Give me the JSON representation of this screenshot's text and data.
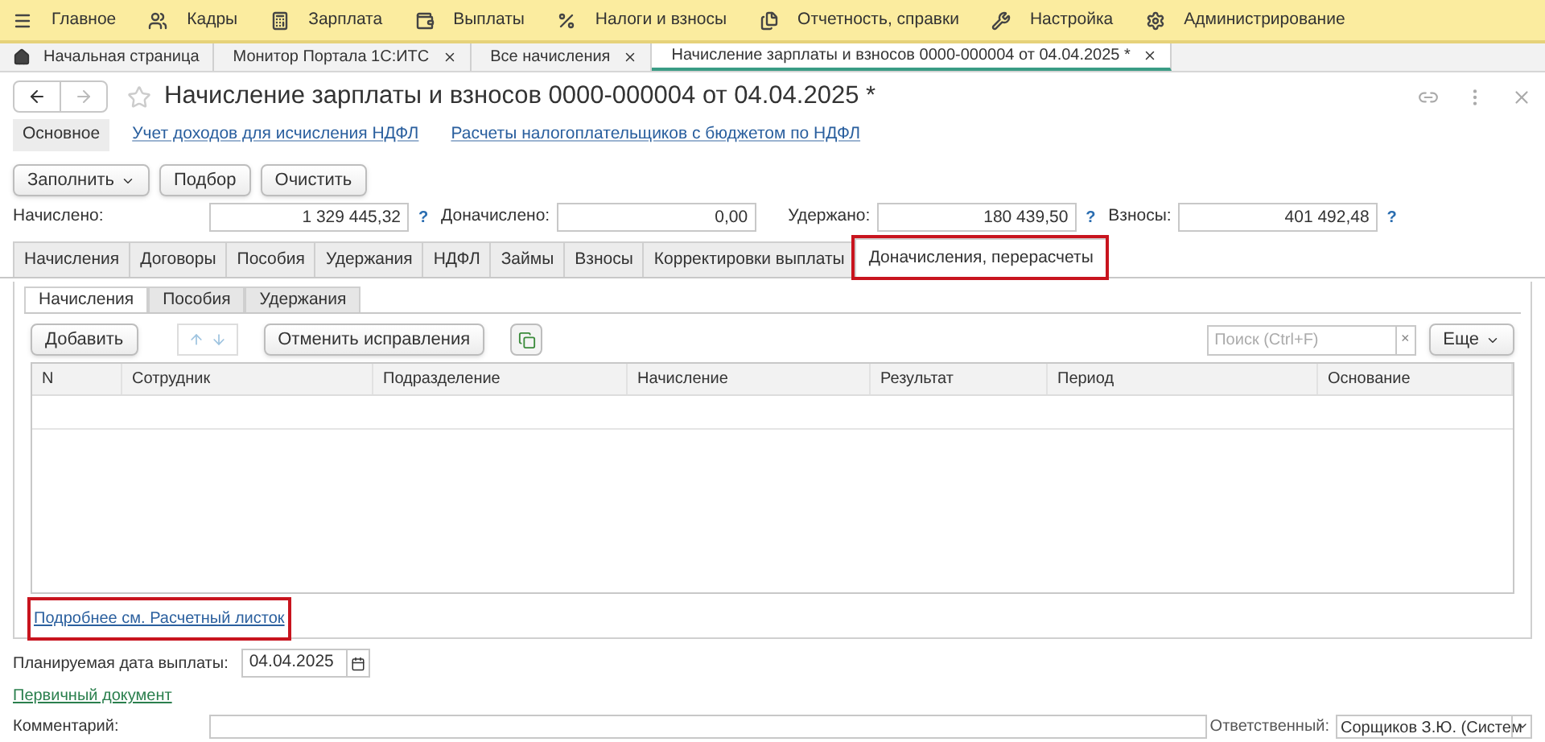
{
  "main_menu": [
    {
      "label": "Главное"
    },
    {
      "label": "Кадры"
    },
    {
      "label": "Зарплата"
    },
    {
      "label": "Выплаты"
    },
    {
      "label": "Налоги и взносы"
    },
    {
      "label": "Отчетность, справки"
    },
    {
      "label": "Настройка"
    },
    {
      "label": "Администрирование"
    }
  ],
  "open_windows": [
    {
      "label": "Начальная страница",
      "home": true,
      "closable": false,
      "selected": false
    },
    {
      "label": "Монитор Портала 1С:ИТС",
      "home": false,
      "closable": true,
      "selected": false
    },
    {
      "label": "Все начисления",
      "home": false,
      "closable": true,
      "selected": false
    },
    {
      "label": "Начисление зарплаты и взносов 0000-000004 от 04.04.2025 *",
      "home": false,
      "closable": true,
      "selected": true
    }
  ],
  "document": {
    "title": "Начисление зарплаты и взносов 0000-000004 от 04.04.2025 *",
    "favorite": false
  },
  "sections": [
    {
      "label": "Основное",
      "selected": true
    },
    {
      "label": "Учет доходов для исчисления НДФЛ",
      "selected": false
    },
    {
      "label": "Расчеты налогоплательщиков с бюджетом по НДФЛ",
      "selected": false
    }
  ],
  "command_buttons": [
    {
      "label": "Заполнить",
      "dropdown": true
    },
    {
      "label": "Подбор",
      "dropdown": false
    },
    {
      "label": "Очистить",
      "dropdown": false
    }
  ],
  "totals": [
    {
      "label": "Начислено:",
      "value": "1 329 445,32",
      "help": "?"
    },
    {
      "label": "Доначислено:",
      "value": "0,00"
    },
    {
      "label": "Удержано:",
      "value": "180 439,50",
      "help": "?"
    },
    {
      "label": "Взносы:",
      "value": "401 492,48",
      "help": "?"
    }
  ],
  "tabs": [
    {
      "label": "Начисления",
      "selected": false,
      "highlighted": false
    },
    {
      "label": "Договоры",
      "selected": false,
      "highlighted": false
    },
    {
      "label": "Пособия",
      "selected": false,
      "highlighted": false
    },
    {
      "label": "Удержания",
      "selected": false,
      "highlighted": false
    },
    {
      "label": "НДФЛ",
      "selected": false,
      "highlighted": false
    },
    {
      "label": "Займы",
      "selected": false,
      "highlighted": false
    },
    {
      "label": "Взносы",
      "selected": false,
      "highlighted": false
    },
    {
      "label": "Корректировки выплаты",
      "selected": false,
      "highlighted": false
    },
    {
      "label": "Доначисления, перерасчеты",
      "selected": true,
      "highlighted": true
    }
  ],
  "subtabs": [
    {
      "label": "Начисления",
      "selected": true
    },
    {
      "label": "Пособия",
      "selected": false
    },
    {
      "label": "Удержания",
      "selected": false
    }
  ],
  "toolbar": {
    "add": "Добавить",
    "undo": "Отменить исправления",
    "search": {
      "placeholder": "Поиск (Ctrl+F)",
      "clear": "×"
    },
    "more": "Еще"
  },
  "table": {
    "columns": [
      "N",
      "Сотрудник",
      "Подразделение",
      "Начисление",
      "Результат",
      "Период",
      "Основание"
    ]
  },
  "details_link": {
    "label": "Подробнее см. Расчетный листок",
    "highlighted": true
  },
  "planned_date": {
    "label": "Планируемая дата выплаты:",
    "value": "04.04.2025"
  },
  "primary_document": "Первичный документ",
  "comment": {
    "label": "Комментарий:"
  },
  "responsible": {
    "label": "Ответственный:",
    "value": "Сорщиков З.Ю. (Систем"
  }
}
